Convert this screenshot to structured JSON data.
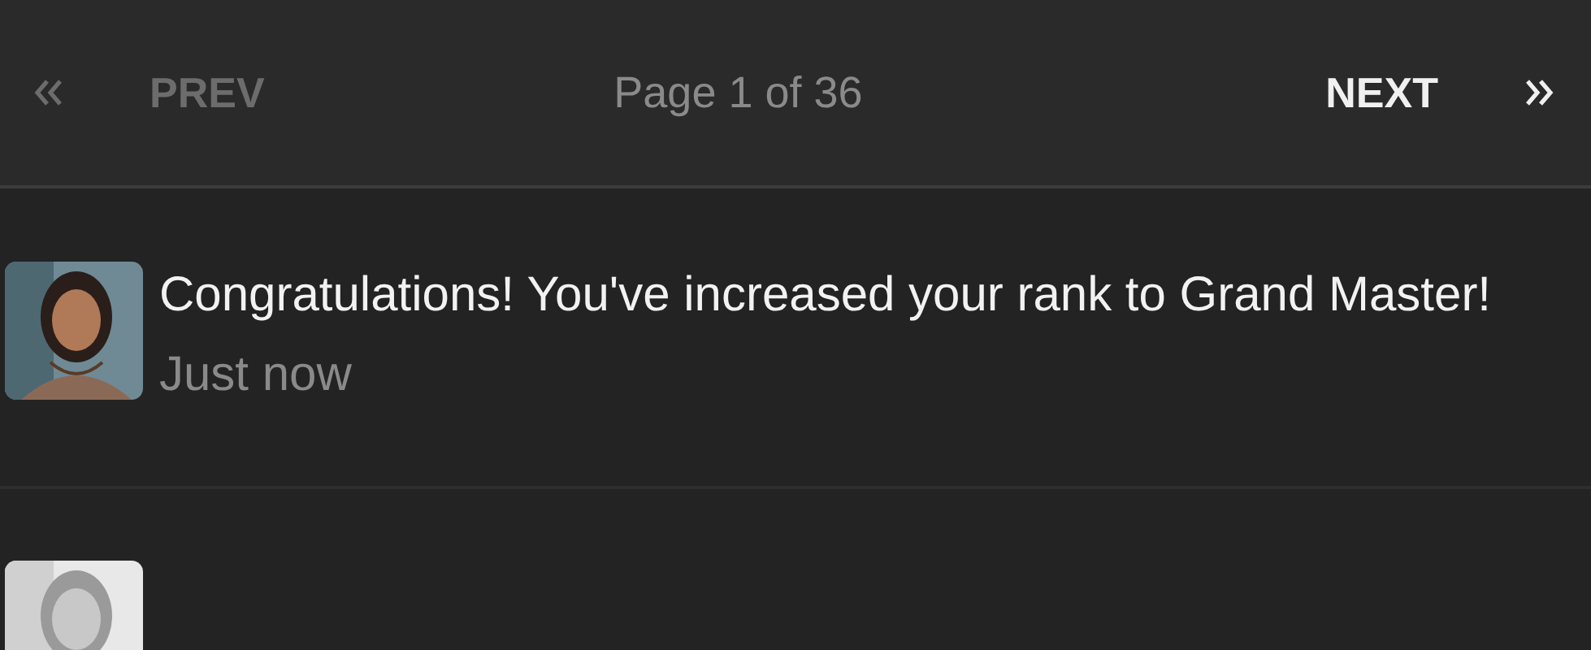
{
  "pager": {
    "prev": {
      "label": "PREV",
      "disabled": true
    },
    "status": "Page 1 of 36",
    "next": {
      "label": "NEXT",
      "disabled": false
    }
  },
  "notifications": [
    {
      "avatar": {
        "kind": "picture"
      },
      "message": "Congratulations! You've increased your rank to Grand Master!",
      "time": "Just now"
    },
    {
      "avatar": {
        "kind": "picture"
      }
    }
  ]
}
